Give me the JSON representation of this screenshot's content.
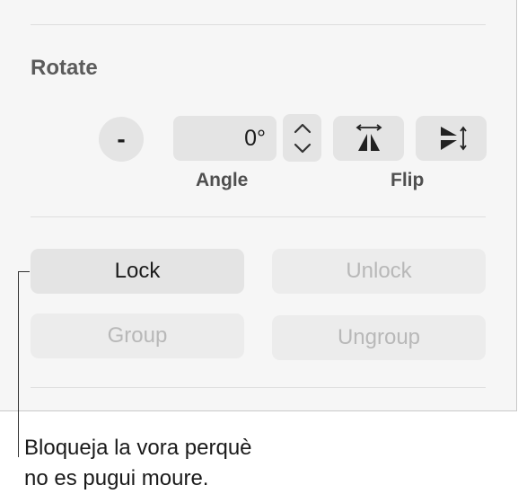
{
  "rotate": {
    "title": "Rotate",
    "minus_label": "-",
    "angle_value": "0°",
    "angle_caption": "Angle",
    "flip_caption": "Flip"
  },
  "arrange": {
    "lock_label": "Lock",
    "unlock_label": "Unlock",
    "group_label": "Group",
    "ungroup_label": "Ungroup"
  },
  "callout": {
    "text": "Bloqueja la vora perquè\nno es pugui moure."
  },
  "icons": {
    "stepper": "chevron-up-down-icon",
    "flip_horizontal": "flip-horizontal-icon",
    "flip_vertical": "flip-vertical-icon"
  },
  "colors": {
    "panel_background": "#f6f6f6",
    "button_background": "#e4e4e4",
    "disabled_text": "#b8b8b8"
  }
}
